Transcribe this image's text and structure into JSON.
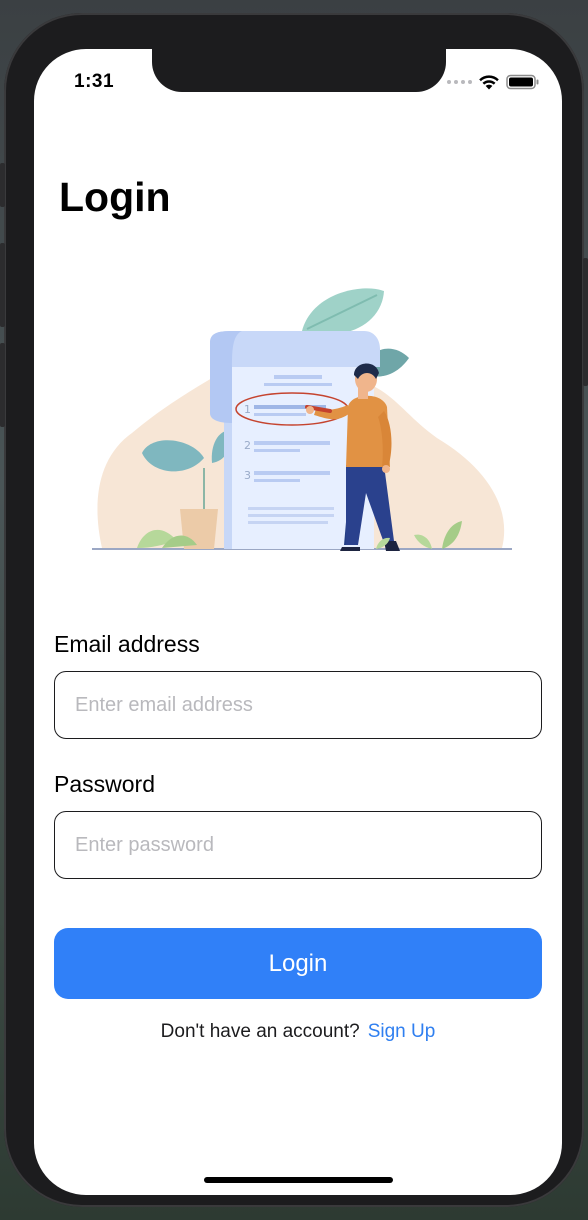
{
  "status_bar": {
    "time": "1:31",
    "icons": [
      "signal-dots-icon",
      "wifi-icon",
      "battery-icon"
    ]
  },
  "page": {
    "title": "Login",
    "illustration": "checklist-person-illustration"
  },
  "form": {
    "email": {
      "label": "Email address",
      "placeholder": "Enter email address",
      "value": ""
    },
    "password": {
      "label": "Password",
      "placeholder": "Enter password",
      "value": ""
    },
    "submit_label": "Login"
  },
  "footer": {
    "prompt": "Don't have an account?",
    "signup_label": "Sign Up"
  },
  "colors": {
    "primary": "#3080f8",
    "link": "#2f7ff0",
    "input_border": "#1c1c1e",
    "placeholder": "#b9b9bd"
  }
}
